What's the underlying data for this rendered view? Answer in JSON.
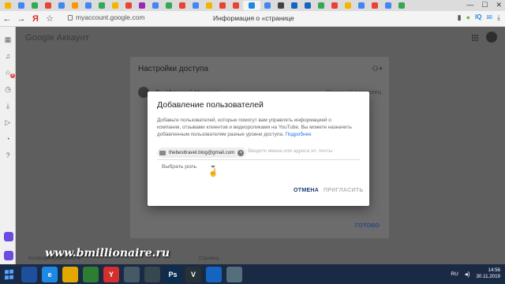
{
  "browser": {
    "tabs": [
      {
        "color": "#f4b400"
      },
      {
        "color": "#4285f4"
      },
      {
        "color": "#34a853"
      },
      {
        "color": "#ea4335"
      },
      {
        "color": "#4285f4"
      },
      {
        "color": "#ff9800"
      },
      {
        "color": "#4285f4"
      },
      {
        "color": "#34a853"
      },
      {
        "color": "#f4b400"
      },
      {
        "color": "#ea4335"
      },
      {
        "color": "#9c27b0"
      },
      {
        "color": "#4285f4"
      },
      {
        "color": "#34a853"
      },
      {
        "color": "#ea4335"
      },
      {
        "color": "#4285f4"
      },
      {
        "color": "#f4b400"
      },
      {
        "color": "#ea4335"
      },
      {
        "color": "#ea4335"
      },
      {
        "color": "#1e88e5"
      },
      {
        "color": "#4285f4"
      },
      {
        "color": "#424242"
      },
      {
        "color": "#1565c0"
      },
      {
        "color": "#1565c0"
      },
      {
        "color": "#34a853"
      },
      {
        "color": "#ea4335"
      },
      {
        "color": "#f4b400"
      },
      {
        "color": "#4285f4"
      },
      {
        "color": "#ea4335"
      },
      {
        "color": "#4285f4"
      },
      {
        "color": "#34a853"
      }
    ],
    "window_controls": {
      "minimize": "—",
      "maximize": "☐",
      "close": "✕"
    },
    "address": {
      "back": "←",
      "forward": "→",
      "yandex_label": "Я",
      "url": "myaccount.google.com",
      "page_info": "Информация о «странице"
    }
  },
  "sidebar": {
    "icons": [
      "grid-icon",
      "bell-icon",
      "star-icon",
      "history-icon",
      "download-icon",
      "play-icon",
      "clock-icon",
      "help-icon"
    ],
    "badge": "8"
  },
  "page": {
    "logo": "Google Аккаунт",
    "access_card": {
      "title": "Настройки доступа",
      "owner_name": "Вы (Алексей Минаев)",
      "owner_role": "Основной владелец",
      "done": "ГОТОВО"
    },
    "footer": {
      "left": "Конфиденциальность",
      "right": "Справка"
    }
  },
  "dialog": {
    "title": "Добавление пользователей",
    "description": "Добавьте пользователей, которые помогут вам управлять информацией о компании, отзывами клиентов и видеороликами на YouTube. Вы можете назначить добавленным пользователям разные уровни доступа.",
    "learn_more": "Подробнее",
    "chip_email": "thebesttravel.blog@gmail.com",
    "input_placeholder": "Введите имена или адреса эл. почты",
    "role_select": "Выбрать роль",
    "cancel": "ОТМЕНА",
    "invite": "ПРИГЛАСИТЬ"
  },
  "watermark": "www.bmillionaire.ru",
  "taskbar": {
    "apps": [
      {
        "label": "",
        "color": "#1e4f9c"
      },
      {
        "label": "e",
        "color": "#1e88e5"
      },
      {
        "label": "",
        "color": "#e0a800"
      },
      {
        "label": "",
        "color": "#2e7d32"
      },
      {
        "label": "Y",
        "color": "#d32f2f"
      },
      {
        "label": "",
        "color": "#455a64"
      },
      {
        "label": "",
        "color": "#37474f"
      },
      {
        "label": "Ps",
        "color": "#0b2d4f"
      },
      {
        "label": "V",
        "color": "#263238"
      },
      {
        "label": "",
        "color": "#1565c0"
      },
      {
        "label": "",
        "color": "#546e7a"
      }
    ],
    "lang": "RU",
    "time": "14:56",
    "date": "30.11.2019"
  }
}
